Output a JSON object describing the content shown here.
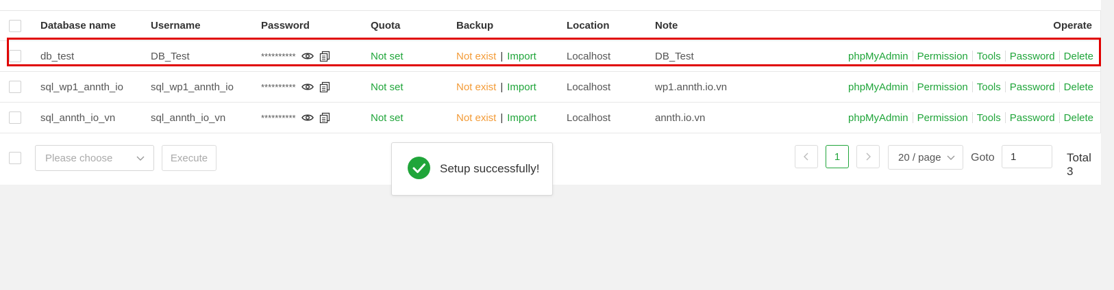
{
  "table": {
    "headers": {
      "database_name": "Database name",
      "username": "Username",
      "password": "Password",
      "quota": "Quota",
      "backup": "Backup",
      "location": "Location",
      "note": "Note",
      "operate": "Operate"
    },
    "rows": [
      {
        "name": "db_test",
        "username": "DB_Test",
        "password_mask": "**********",
        "quota": "Not set",
        "backup_status": "Not exist",
        "backup_sep": "|",
        "backup_action": "Import",
        "location": "Localhost",
        "note": "DB_Test"
      },
      {
        "name": "sql_wp1_annth_io",
        "username": "sql_wp1_annth_io",
        "password_mask": "**********",
        "quota": "Not set",
        "backup_status": "Not exist",
        "backup_sep": "|",
        "backup_action": "Import",
        "location": "Localhost",
        "note": "wp1.annth.io.vn"
      },
      {
        "name": "sql_annth_io_vn",
        "username": "sql_annth_io_vn",
        "password_mask": "**********",
        "quota": "Not set",
        "backup_status": "Not exist",
        "backup_sep": "|",
        "backup_action": "Import",
        "location": "Localhost",
        "note": "annth.io.vn"
      }
    ],
    "operations": [
      "phpMyAdmin",
      "Permission",
      "Tools",
      "Password",
      "Delete"
    ]
  },
  "footer": {
    "batch_placeholder": "Please choose",
    "execute_label": "Execute",
    "pagination": {
      "current_page": "1",
      "per_page": "20 / page",
      "goto_label": "Goto",
      "goto_value": "1",
      "total": "Total 3"
    }
  },
  "toast": {
    "message": "Setup successfully!"
  },
  "colors": {
    "accent_green": "#20a53a",
    "warning_orange": "#f39b37",
    "highlight_red": "#e00000"
  },
  "icons": {
    "view_password": "eye-icon",
    "copy_password": "copy-icon",
    "success": "check-circle-icon"
  }
}
